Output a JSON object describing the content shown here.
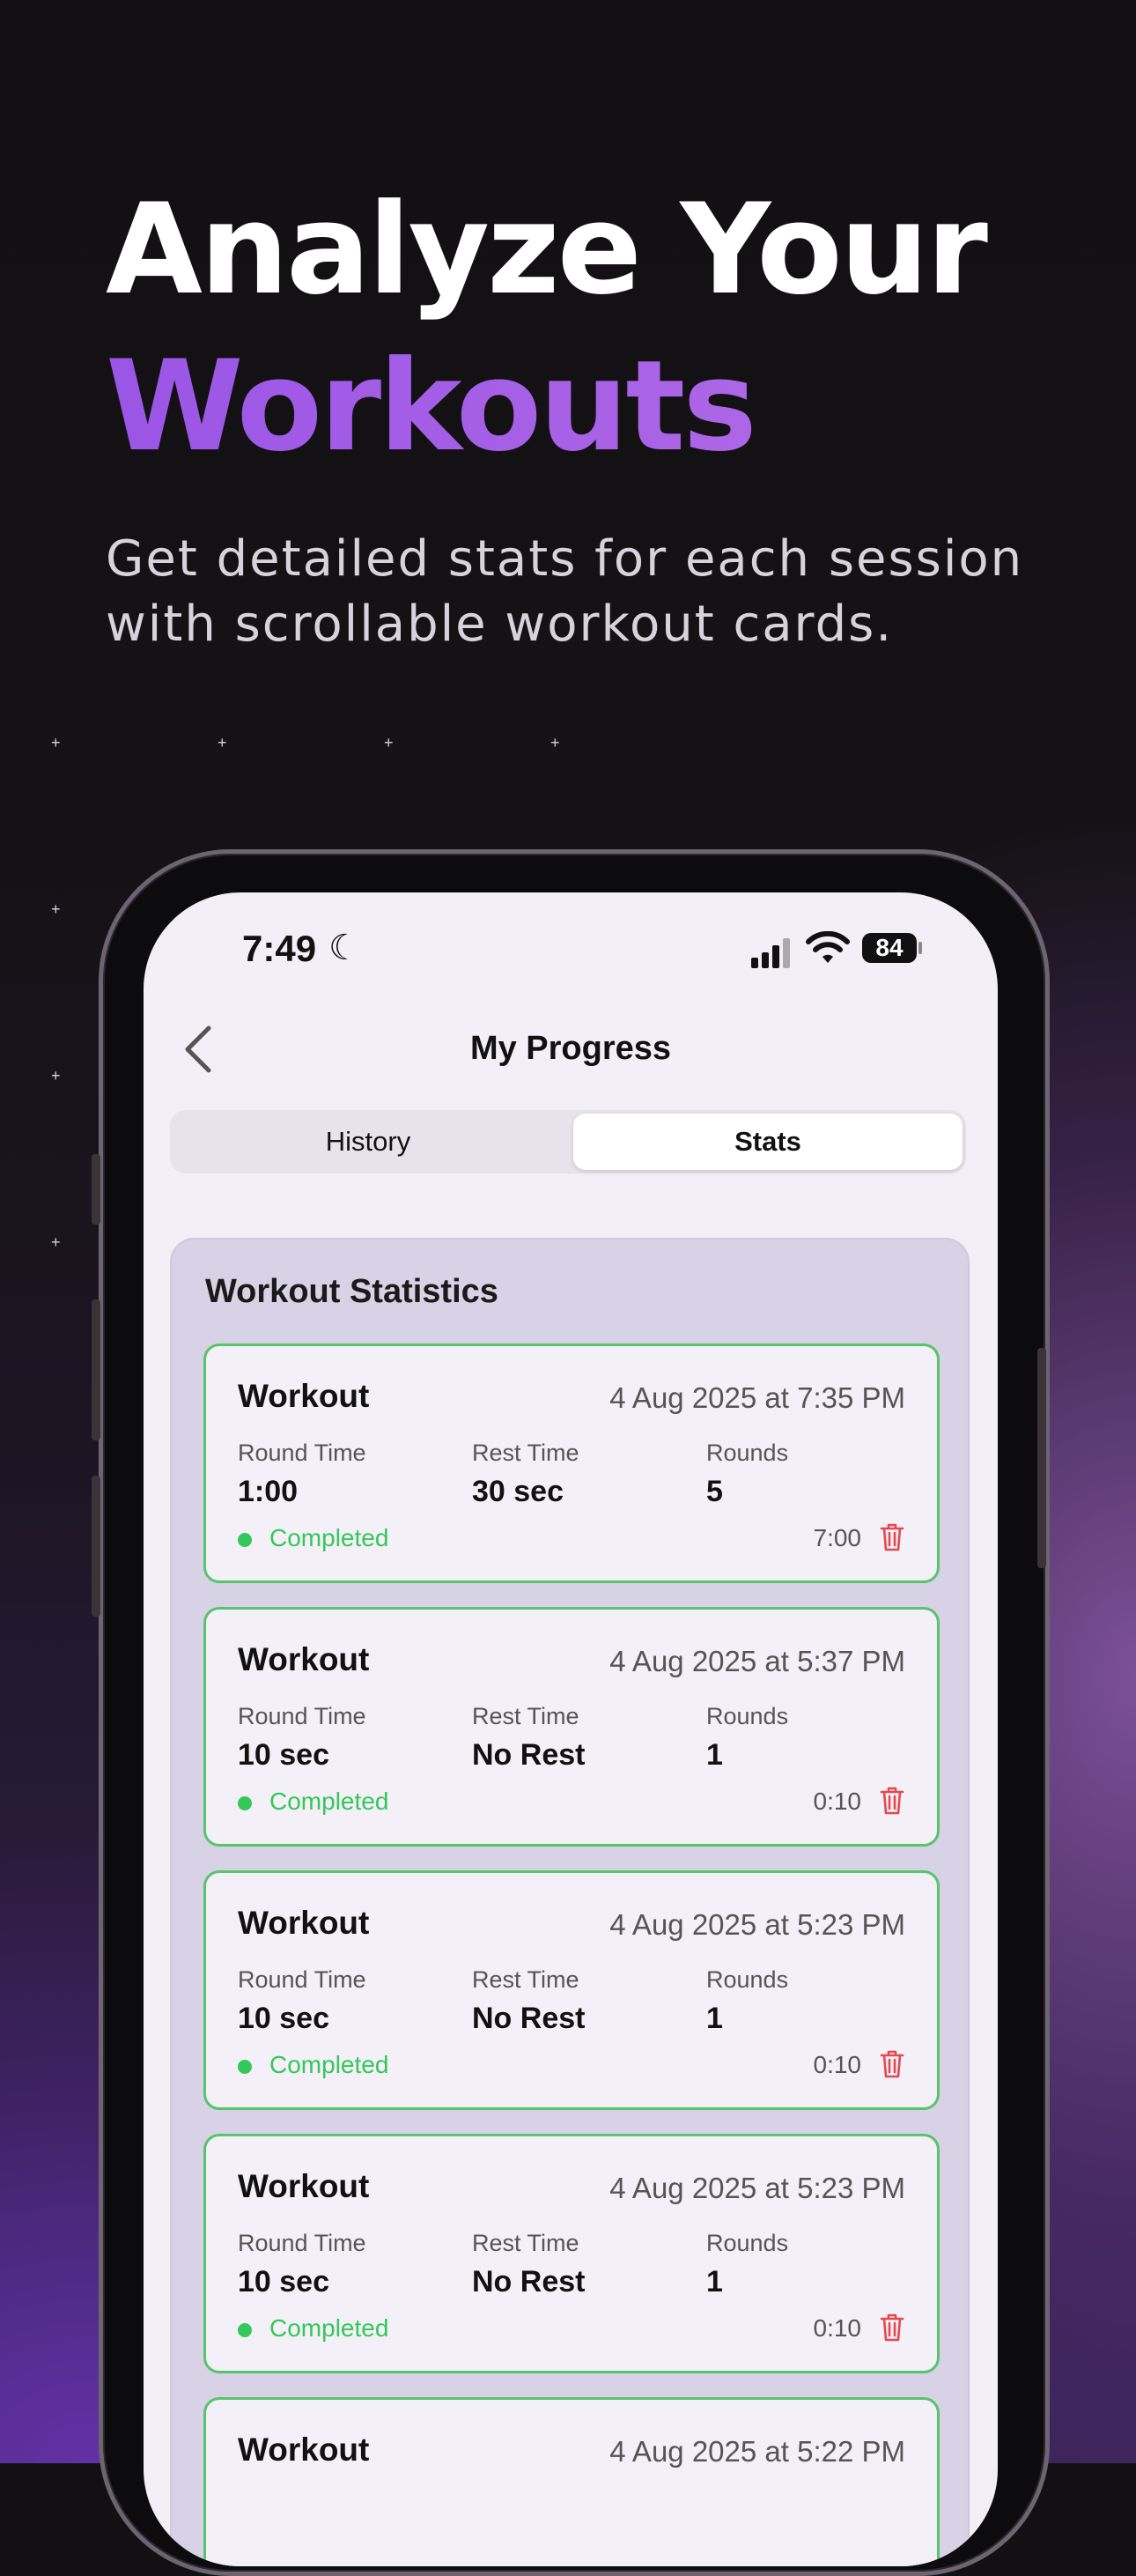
{
  "headline": {
    "line1": "Analyze Your",
    "line2": "Workouts"
  },
  "subtitle": "Get detailed stats for each session with scrollable workout cards.",
  "status_bar": {
    "time": "7:49",
    "battery": "84"
  },
  "nav": {
    "title": "My Progress"
  },
  "tabs": [
    {
      "label": "History",
      "active": false
    },
    {
      "label": "Stats",
      "active": true
    }
  ],
  "stats": {
    "title": "Workout Statistics",
    "labels": {
      "round_time": "Round Time",
      "rest_time": "Rest Time",
      "rounds": "Rounds"
    },
    "workouts": [
      {
        "name": "Workout",
        "date": "4 Aug 2025 at 7:35 PM",
        "round_time": "1:00",
        "rest_time": "30 sec",
        "rounds": "5",
        "status": "Completed",
        "duration": "7:00"
      },
      {
        "name": "Workout",
        "date": "4 Aug 2025 at 5:37 PM",
        "round_time": "10 sec",
        "rest_time": "No Rest",
        "rounds": "1",
        "status": "Completed",
        "duration": "0:10"
      },
      {
        "name": "Workout",
        "date": "4 Aug 2025 at 5:23 PM",
        "round_time": "10 sec",
        "rest_time": "No Rest",
        "rounds": "1",
        "status": "Completed",
        "duration": "0:10"
      },
      {
        "name": "Workout",
        "date": "4 Aug 2025 at 5:23 PM",
        "round_time": "10 sec",
        "rest_time": "No Rest",
        "rounds": "1",
        "status": "Completed",
        "duration": "0:10"
      },
      {
        "name": "Workout",
        "date": "4 Aug 2025 at 5:22 PM"
      }
    ]
  },
  "colors": {
    "accent": "#a764e8",
    "completed": "#34c759",
    "card_border": "#58c46c",
    "delete": "#e5484d"
  }
}
